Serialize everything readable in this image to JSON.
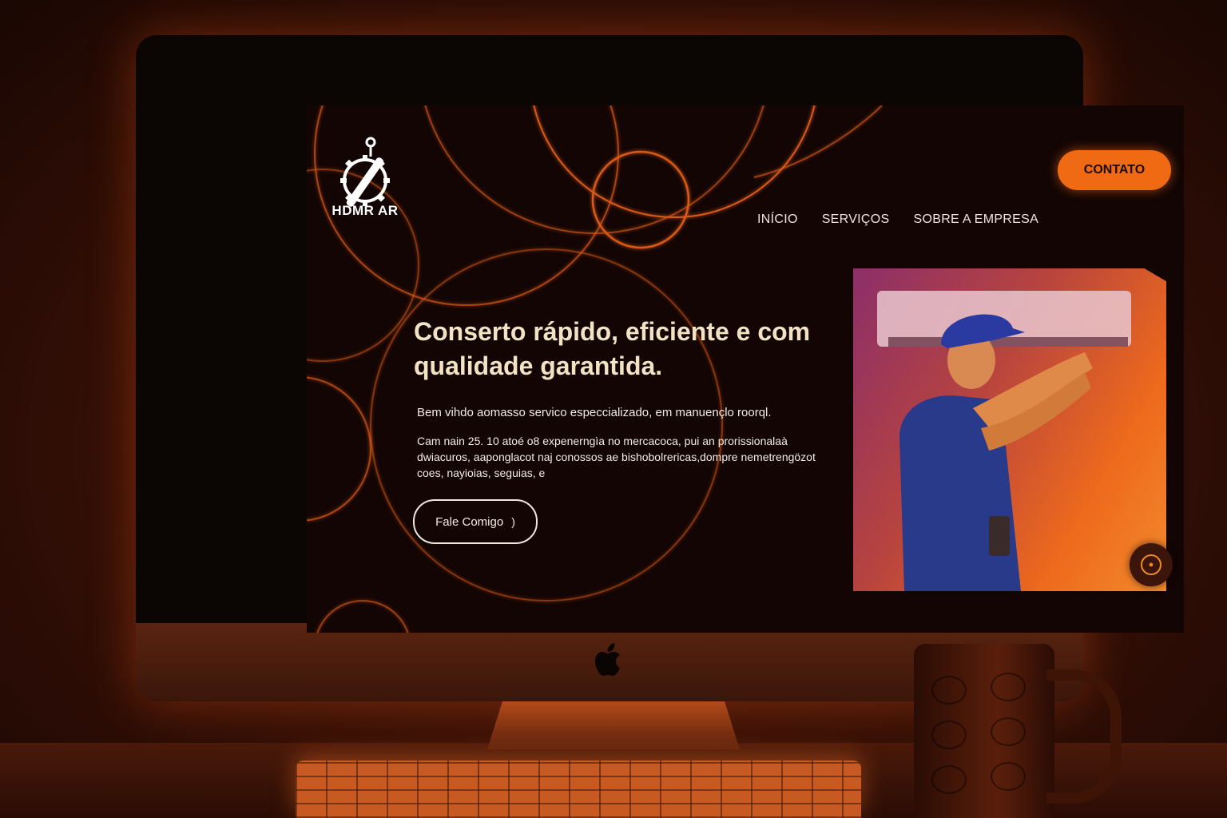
{
  "brand": {
    "name": "HDMR AR"
  },
  "header": {
    "contact_label": "CONTATO",
    "nav": [
      {
        "label": "INÍCIO"
      },
      {
        "label": "SERVIÇOS"
      },
      {
        "label": "SOBRE A EMPRESA"
      }
    ]
  },
  "hero": {
    "headline": "Conserto rápido, eficiente e com qualidade garantida.",
    "intro": "Bem vihdo aomasso servico especcializado, em manuençlo roorql.",
    "description": "Cam nain 25. 10 atoé o8 expenerngìa no mercacoca, pui an prorissionalaà dwiacuros, aapongl­acot naj conossos ae bishobolrericas,dompre nemetrengözot coes, nayioias, seguias, e",
    "cta_label": "Fale Comigo",
    "cta_arrow": ")"
  },
  "colors": {
    "accent": "#ef6a12",
    "background": "#120504",
    "headline": "#f1e3c4"
  },
  "icons": {
    "logo": "wrench-gear-logo-icon",
    "chat": "chat-bubble-icon",
    "system": "apple-logo-icon"
  }
}
